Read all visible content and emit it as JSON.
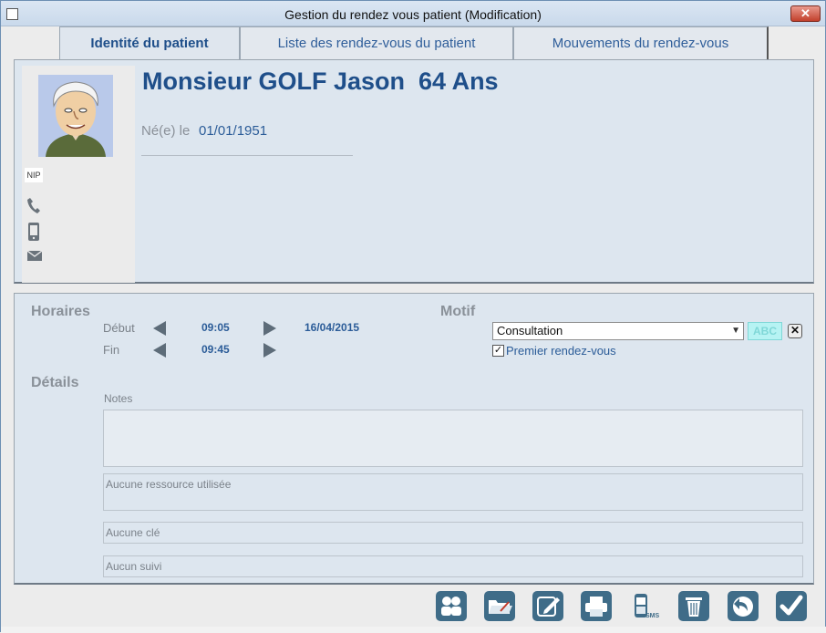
{
  "window": {
    "title": "Gestion du rendez vous patient (Modification)",
    "close_label": "✕"
  },
  "tabs": [
    {
      "label": "Identité du patient",
      "active": true
    },
    {
      "label": "Liste des rendez-vous du patient",
      "active": false
    },
    {
      "label": "Mouvements du rendez-vous",
      "active": false
    }
  ],
  "patient": {
    "name": "Monsieur GOLF Jason  64 Ans",
    "dob_label": "Né(e) le",
    "dob": "01/01/1951",
    "nip_label": "NIP",
    "contact_icons": [
      "phone-icon",
      "mobile-icon",
      "email-icon"
    ]
  },
  "horaires": {
    "title": "Horaires",
    "debut_label": "Début",
    "debut_time": "09:05",
    "date": "16/04/2015",
    "fin_label": "Fin",
    "fin_time": "09:45"
  },
  "motif": {
    "title": "Motif",
    "selected": "Consultation",
    "abc_label": "ABC",
    "first_appointment_label": "Premier rendez-vous",
    "first_appointment_checked": true
  },
  "details": {
    "title": "Détails",
    "notes_label": "Notes",
    "notes_value": "",
    "resources": "Aucune ressource utilisée",
    "key": "Aucune clé",
    "followup": "Aucun suivi"
  },
  "toolbar": {
    "icons": [
      "patients-icon",
      "folder-icon",
      "edit-icon",
      "print-icon",
      "sms-icon",
      "delete-icon",
      "undo-icon",
      "validate-icon"
    ],
    "sms_label": "SMS"
  },
  "colors": {
    "accent": "#1f4f8a",
    "panel": "#dde6ef",
    "tool": "#3f6c88"
  }
}
